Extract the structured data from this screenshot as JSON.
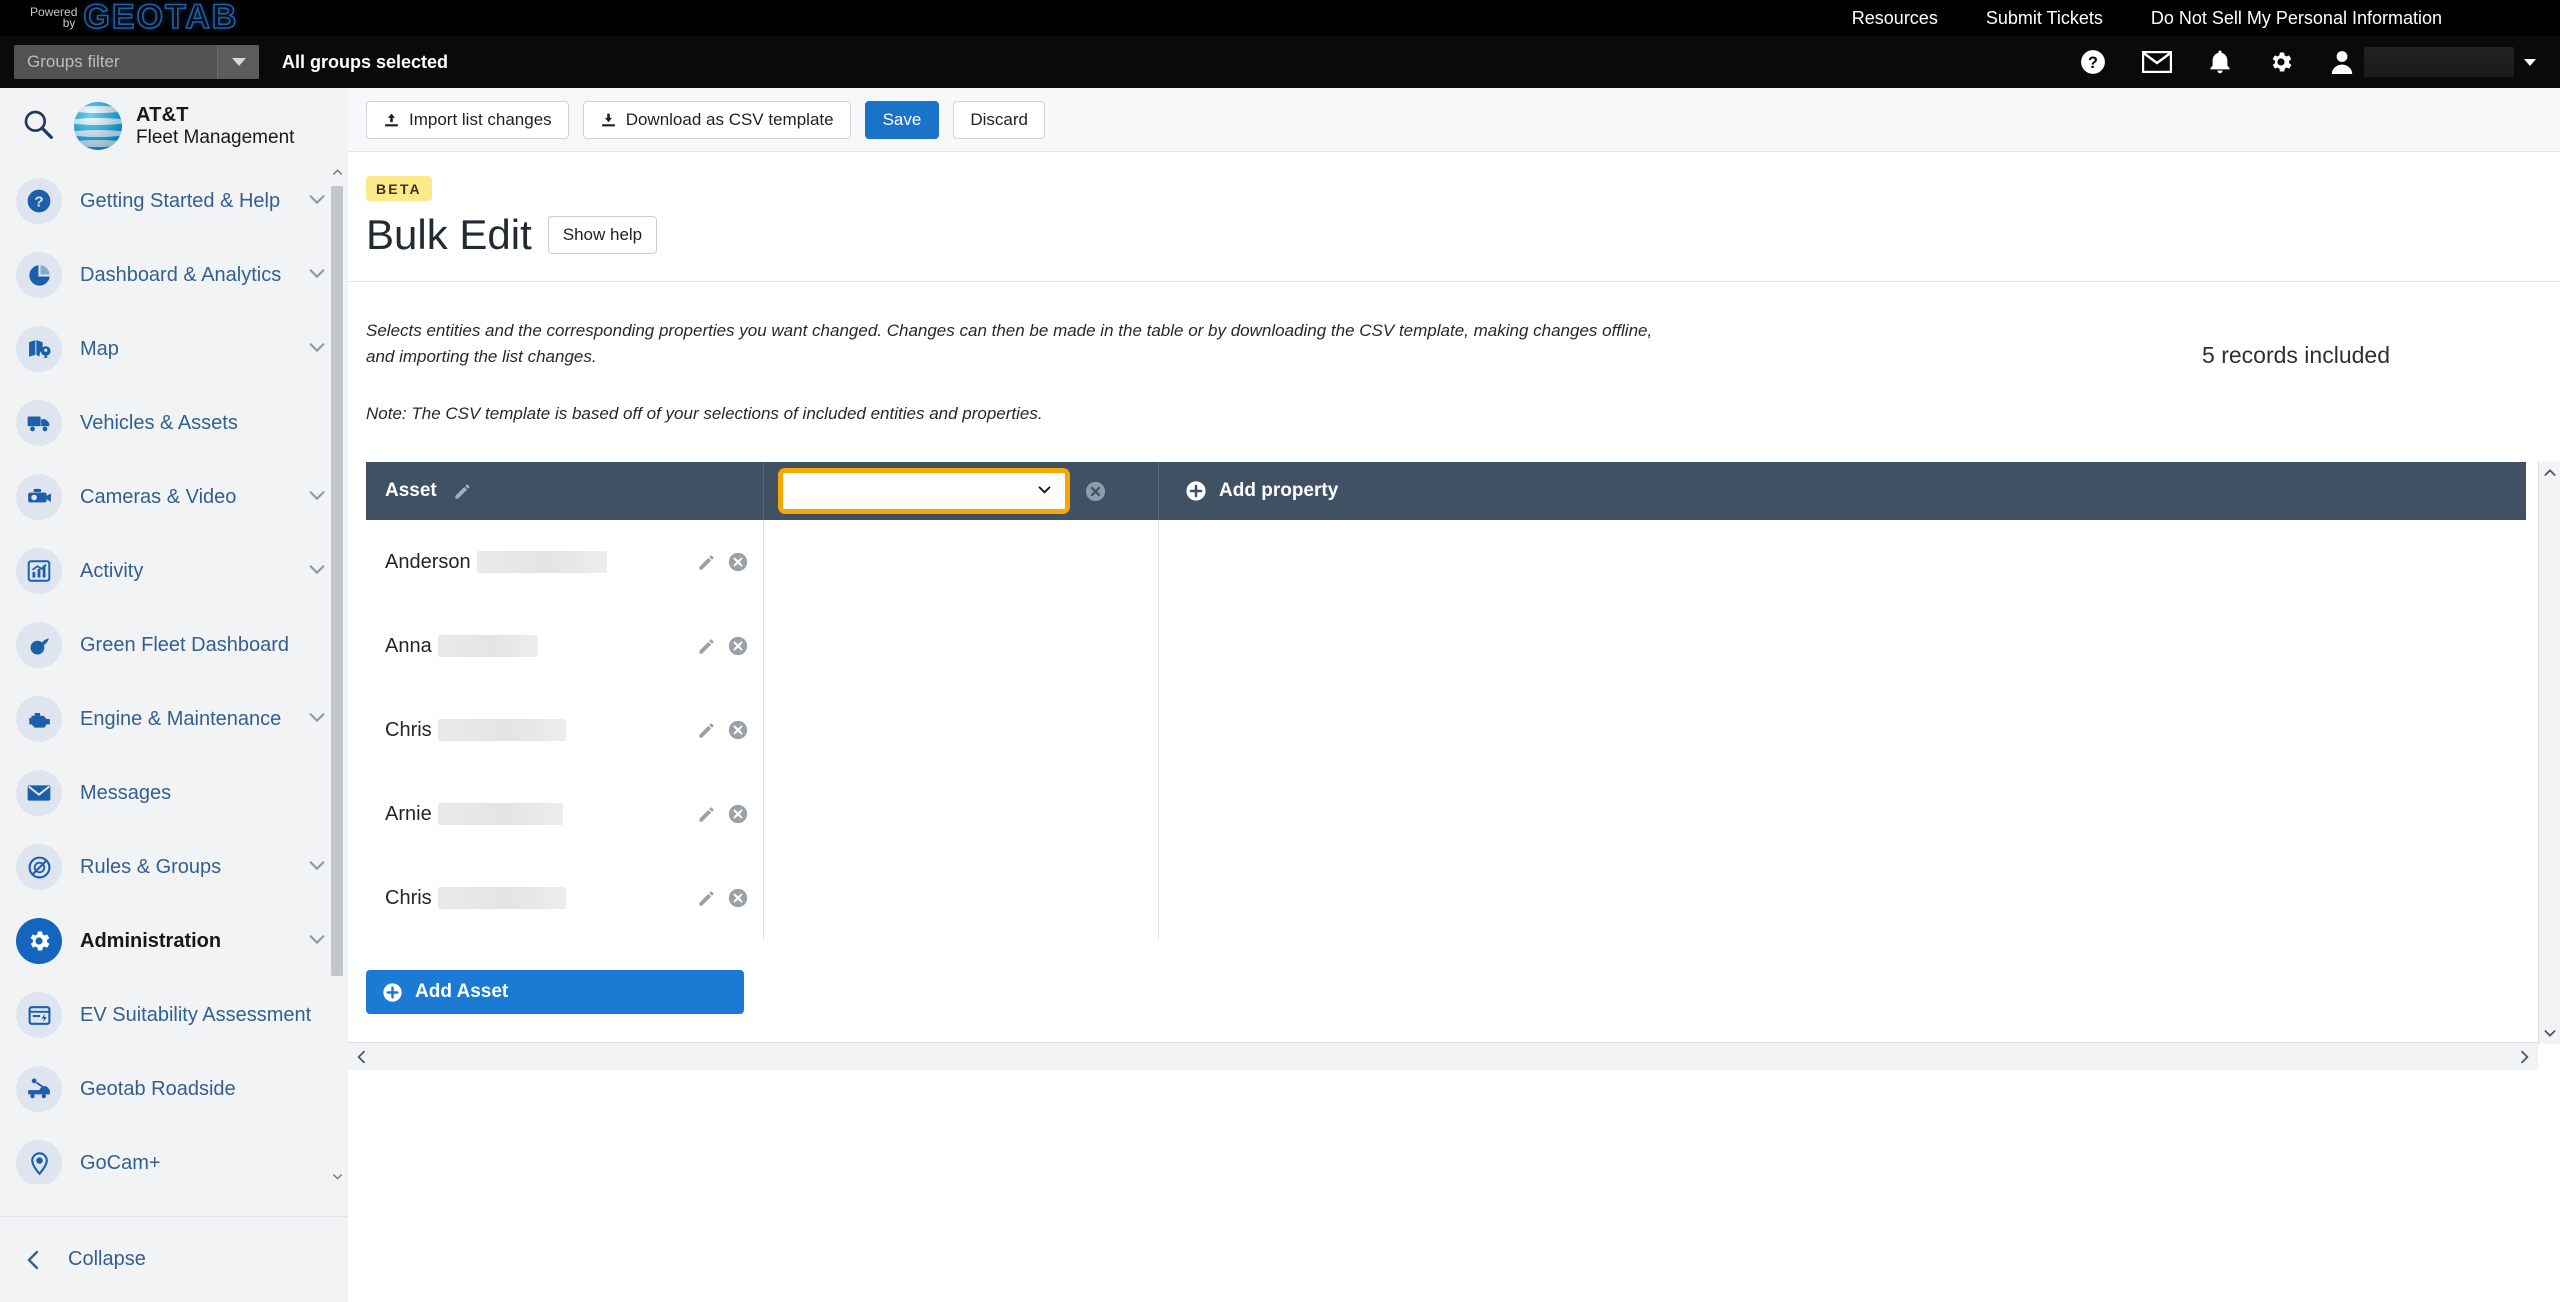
{
  "topbar": {
    "brand": {
      "powered": "Powered",
      "by": "by",
      "name": "GEOTAB"
    },
    "links": [
      {
        "label": "Resources"
      },
      {
        "label": "Submit Tickets"
      },
      {
        "label": "Do Not Sell My Personal Information"
      }
    ]
  },
  "subbar": {
    "groups_filter_placeholder": "Groups filter",
    "all_groups_selected": "All groups selected",
    "icons": [
      "help-icon",
      "mail-icon",
      "bell-icon",
      "gear-icon",
      "user-icon"
    ]
  },
  "sidebar": {
    "brand": {
      "line1": "AT&T",
      "line2": "Fleet Management"
    },
    "search_icon": "search-icon",
    "items": [
      {
        "label": "Getting Started & Help",
        "icon": "question-circle-icon",
        "expandable": true,
        "active": false
      },
      {
        "label": "Dashboard & Analytics",
        "icon": "pie-chart-icon",
        "expandable": true,
        "active": false
      },
      {
        "label": "Map",
        "icon": "map-pin-icon",
        "expandable": true,
        "active": false
      },
      {
        "label": "Vehicles & Assets",
        "icon": "truck-icon",
        "expandable": false,
        "active": false
      },
      {
        "label": "Cameras & Video",
        "icon": "dashcam-icon",
        "expandable": true,
        "active": false
      },
      {
        "label": "Activity",
        "icon": "bar-chart-icon",
        "expandable": true,
        "active": false
      },
      {
        "label": "Green Fleet Dashboard",
        "icon": "leaf-icon",
        "expandable": false,
        "active": false
      },
      {
        "label": "Engine & Maintenance",
        "icon": "engine-icon",
        "expandable": true,
        "active": false
      },
      {
        "label": "Messages",
        "icon": "envelope-icon",
        "expandable": false,
        "active": false
      },
      {
        "label": "Rules & Groups",
        "icon": "rules-icon",
        "expandable": true,
        "active": false
      },
      {
        "label": "Administration",
        "icon": "gear-icon",
        "expandable": true,
        "active": true
      },
      {
        "label": "EV Suitability Assessment",
        "icon": "ev-card-icon",
        "expandable": false,
        "active": false
      },
      {
        "label": "Geotab Roadside",
        "icon": "tow-truck-icon",
        "expandable": false,
        "active": false
      },
      {
        "label": "GoCam+",
        "icon": "camera-pin-icon",
        "expandable": false,
        "active": false
      }
    ],
    "collapse_label": "Collapse"
  },
  "toolbar": {
    "import_label": "Import list changes",
    "download_label": "Download as CSV template",
    "save_label": "Save",
    "discard_label": "Discard"
  },
  "page": {
    "beta_badge": "BETA",
    "title": "Bulk Edit",
    "show_help_label": "Show help",
    "description": "Selects entities and the corresponding properties you want changed. Changes can then be made in the table or by downloading the CSV template, making changes offline, and importing the list changes.",
    "note": "Note: The CSV template is based off of your selections of included entities and properties.",
    "records_included": "5 records included"
  },
  "table": {
    "asset_column_header": "Asset",
    "property_select_value": "",
    "property_select_options": [
      ""
    ],
    "add_property_label": "Add property",
    "add_asset_label": "Add Asset",
    "rows": [
      {
        "name": "Anderson",
        "redacted_width": 130
      },
      {
        "name": "Anna",
        "redacted_width": 100
      },
      {
        "name": "Chris",
        "redacted_width": 128
      },
      {
        "name": "Arnie",
        "redacted_width": 125
      },
      {
        "name": "Chris",
        "redacted_width": 128
      }
    ]
  },
  "colors": {
    "accent_blue": "#1a73c8",
    "header_slate": "#3f5163",
    "focus_orange": "#f7a800",
    "beta_yellow": "#fce98a",
    "sidebar_bg": "#f1f3f5"
  }
}
